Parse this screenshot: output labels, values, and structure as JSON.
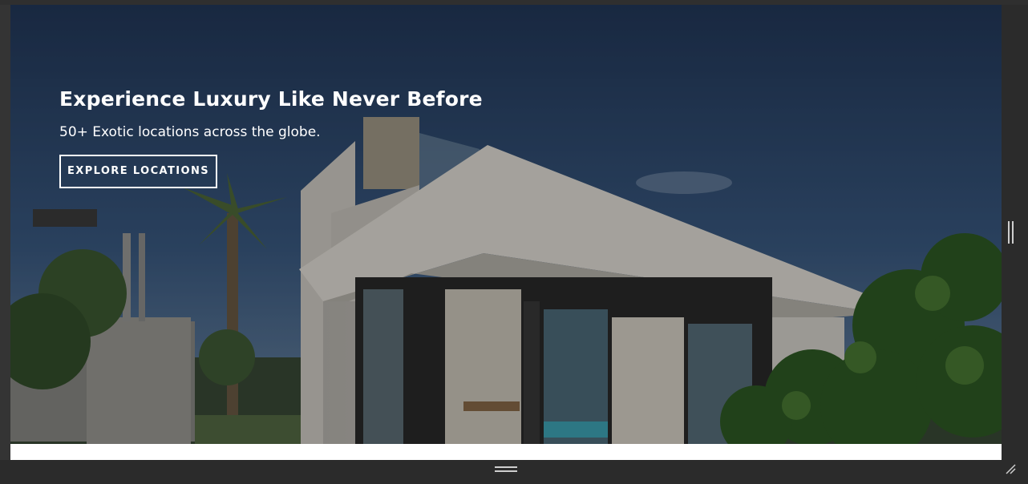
{
  "hero": {
    "title": "Experience Luxury Like Never Before",
    "subtitle": "50+ Exotic locations across the globe.",
    "cta_label": "EXPLORE LOCATIONS"
  },
  "colors": {
    "sky": "#2f4a6e",
    "overlay": "#000000",
    "house": "#c9c6c0",
    "frame": "#343434"
  },
  "icons": {
    "vertical_grip": "vertical-resize-grip-icon",
    "horizontal_grip": "horizontal-resize-grip-icon",
    "corner_resize": "corner-resize-icon"
  }
}
